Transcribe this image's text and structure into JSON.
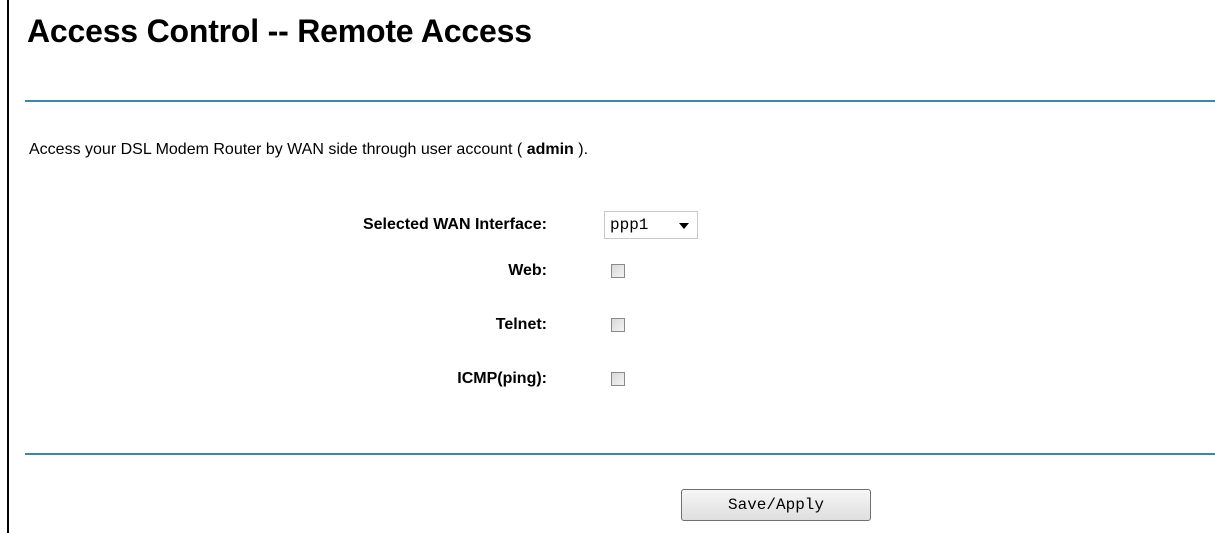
{
  "header": {
    "title": "Access Control -- Remote Access"
  },
  "intro": {
    "prefix": "Access your DSL Modem Router by WAN side through user account ( ",
    "account": "admin",
    "suffix": " )."
  },
  "form": {
    "wan_interface": {
      "label": "Selected WAN Interface:",
      "value": "ppp1"
    },
    "web": {
      "label": "Web:",
      "checked": false
    },
    "telnet": {
      "label": "Telnet:",
      "checked": false
    },
    "icmp": {
      "label": "ICMP(ping):",
      "checked": false
    }
  },
  "actions": {
    "save_label": "Save/Apply"
  },
  "colors": {
    "divider": "#3a87ad"
  }
}
